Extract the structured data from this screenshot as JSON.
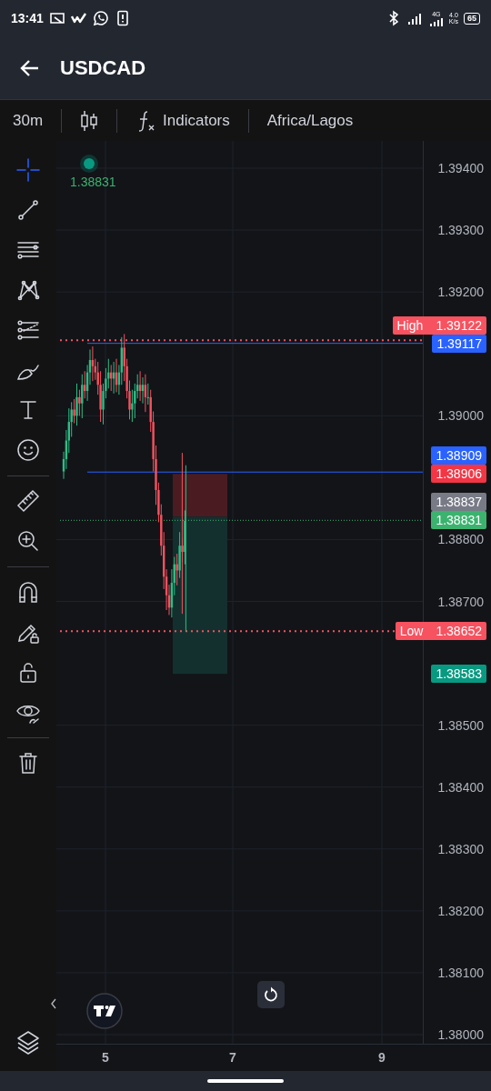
{
  "status_bar": {
    "time": "13:41",
    "network": "4G",
    "speed": [
      "4.0",
      "K/s"
    ],
    "battery": "65"
  },
  "app_bar": {
    "title": "USDCAD"
  },
  "toolbar": {
    "interval": "30m",
    "indicators": "Indicators",
    "timezone": "Africa/Lagos"
  },
  "tool_groups": [
    {
      "tools": [
        {
          "selected": true
        },
        {
          "selected": false
        },
        {
          "selected": false
        },
        {
          "selected": false
        },
        {
          "selected": false
        },
        {
          "selected": false
        },
        {
          "selected": false
        },
        {
          "selected": false
        }
      ]
    },
    {
      "tools": [
        {
          "selected": false
        },
        {
          "selected": false
        }
      ]
    },
    {
      "tools": [
        {
          "selected": false
        },
        {
          "selected": false
        },
        {
          "selected": false
        },
        {
          "selected": false
        }
      ]
    },
    {
      "tools": [
        {
          "selected": false
        }
      ]
    }
  ],
  "chart": {
    "last_price": "1.38831",
    "price_axis": [
      "1.39400",
      "1.39300",
      "1.39200",
      "1.39000",
      "1.38800",
      "1.38700",
      "1.38500",
      "1.38400",
      "1.38300",
      "1.38200",
      "1.38100",
      "1.38000"
    ],
    "time_axis": [
      "5",
      "7",
      "9"
    ],
    "price_tags": [
      {
        "kind": "extreme",
        "label": "High",
        "value": "1.39122",
        "color": "#f7525f"
      },
      {
        "kind": "line",
        "value": "1.39117",
        "color": "#2962ff"
      },
      {
        "kind": "line",
        "value": "1.38909",
        "color": "#2962ff"
      },
      {
        "kind": "level",
        "value": "1.38906",
        "color": "#f23645"
      },
      {
        "kind": "level",
        "value": "1.38837",
        "color": "#787b86"
      },
      {
        "kind": "last",
        "value": "1.38831",
        "color": "#3bb36f"
      },
      {
        "kind": "extreme",
        "label": "Low",
        "value": "1.38652",
        "color": "#f7525f"
      },
      {
        "kind": "level",
        "value": "1.38583",
        "color": "#089981"
      }
    ]
  }
}
